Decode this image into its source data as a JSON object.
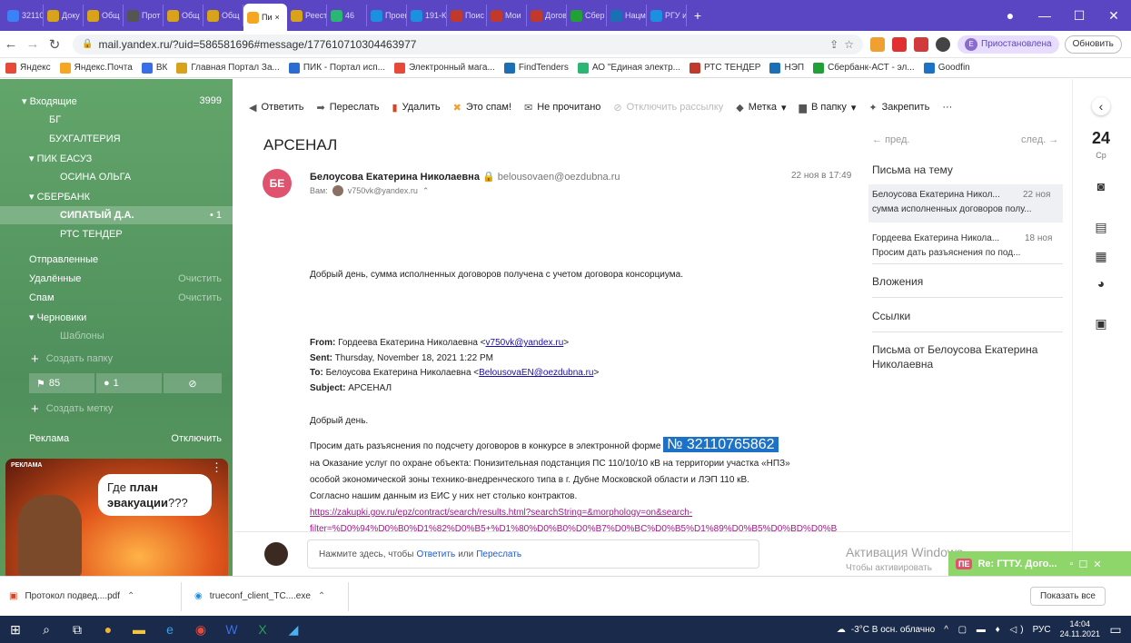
{
  "colors": {
    "tabbar": "#5a46c2",
    "sidebar": "#5a9a62",
    "highlight": "#1d72c7",
    "avatar": "#e0536f",
    "popup": "#8fd66a",
    "taskbar": "#1a2a4a"
  },
  "tabs": [
    {
      "label": "32110",
      "icon": "blue-dot-icon",
      "color": "#3b82f6"
    },
    {
      "label": "Доку",
      "icon": "sun-icon",
      "color": "#d9a21b"
    },
    {
      "label": "Общ",
      "icon": "sun-icon",
      "color": "#d9a21b"
    },
    {
      "label": "Прот",
      "icon": "globe-icon",
      "color": "#555"
    },
    {
      "label": "Общ",
      "icon": "sun-icon",
      "color": "#d9a21b"
    },
    {
      "label": "Общ",
      "icon": "sun-icon",
      "color": "#d9a21b"
    },
    {
      "label": "Пи",
      "icon": "yandex-mail-icon",
      "color": "#f5a623",
      "active": true
    },
    {
      "label": "Реест",
      "icon": "sun-icon",
      "color": "#d9a21b"
    },
    {
      "label": "46",
      "icon": "app-icon",
      "color": "#2bb673"
    },
    {
      "label": "Проек",
      "icon": "app-icon",
      "color": "#1d8fe1"
    },
    {
      "label": "191-К",
      "icon": "app-icon",
      "color": "#1d8fe1"
    },
    {
      "label": "Поис",
      "icon": "rts-icon",
      "color": "#c0392b"
    },
    {
      "label": "Мои",
      "icon": "rts-icon",
      "color": "#c0392b"
    },
    {
      "label": "Догов",
      "icon": "rts-icon",
      "color": "#c0392b"
    },
    {
      "label": "Сбер",
      "icon": "sber-icon",
      "color": "#21a038"
    },
    {
      "label": "Нацм",
      "icon": "nac-icon",
      "color": "#1a6fb5"
    },
    {
      "label": "РГУ и",
      "icon": "rgu-icon",
      "color": "#1d8fe1"
    }
  ],
  "address": {
    "url": "mail.yandex.ru/?uid=586581696#message/177610710304463977",
    "profile_label": "Приостановлена",
    "update_label": "Обновить",
    "profile_letter": "Е"
  },
  "bookmarks": [
    "Яндекс",
    "Яндекс.Почта",
    "ВК",
    "Главная Портал За...",
    "ПИК - Портал исп...",
    "Электронный мага...",
    "FindTenders",
    "АО \"Единая электр...",
    "РТС ТЕНДЕР",
    "НЭП",
    "Сбербанк-АСТ - эл...",
    "Goodfin"
  ],
  "sidebar": {
    "inbox": {
      "label": "▾ Входящие",
      "count": "3999"
    },
    "items": [
      {
        "label": "БГ",
        "indent": 2
      },
      {
        "label": "БУХГАЛТЕРИЯ",
        "indent": 2
      },
      {
        "label": "▾ ПИК ЕАСУЗ",
        "indent": 1
      },
      {
        "label": "ОСИНА ОЛЬГА",
        "indent": 3
      },
      {
        "label": "▾ СБЕРБАНК",
        "indent": 1
      },
      {
        "label": "СИПАТЫЙ Д.А.",
        "indent": 3,
        "count": "• 1",
        "bold": true
      },
      {
        "label": "РТС ТЕНДЕР",
        "indent": 3
      }
    ],
    "sent": "Отправленные",
    "deleted": "Удалённые",
    "deleted_action": "Очистить",
    "spam": "Спам",
    "spam_action": "Очистить",
    "drafts": "▾ Черновики",
    "templates": "Шаблоны",
    "create_folder": "Создать папку",
    "flag_count": "85",
    "dot_count": "1",
    "create_label": "Создать метку",
    "ads_label": "Реклама",
    "ads_disable": "Отключить",
    "ad_tag": "РЕКЛАМА",
    "ad_text_1": "Где ",
    "ad_text_bold": "план",
    "ad_text_2": "эвакуации",
    "ad_text_3": "???"
  },
  "toolbar": [
    "Ответить",
    "Переслать",
    "Удалить",
    "Это спам!",
    "Не прочитано",
    "Отключить рассылку",
    "Метка",
    "В папку",
    "Закрепить",
    "···"
  ],
  "message": {
    "subject": "АРСЕНАЛ",
    "avatar": "БЕ",
    "from_name": "Белоусова Екатерина Николаевна",
    "from_email": "belousovaen@oezdubna.ru",
    "date": "22 ноя в 17:49",
    "to_label": "Вам:",
    "to_email": "v750vk@yandex.ru",
    "greeting_line": "Добрый день, сумма исполненных договоров получена с учетом договора консорциума.",
    "fwd_from_label": "From:",
    "fwd_from": " Гордеева Екатерина Николаевна <",
    "fwd_from_email": "v750vk@yandex.ru",
    "fwd_from_end": ">",
    "fwd_sent_label": "Sent:",
    "fwd_sent": " Thursday, November 18, 2021 1:22 PM",
    "fwd_to_label": "To:",
    "fwd_to": " Белоусова Екатерина Николаевна <",
    "fwd_to_email": "BelousovaEN@oezdubna.ru",
    "fwd_to_end": ">",
    "fwd_subject_label": "Subject:",
    "fwd_subject": " АРСЕНАЛ",
    "hello": "Добрый день.",
    "body_1": "Просим дать разъяснения по подсчету договоров в конкурсе в электронной форме ",
    "highlight": "№ 32110765862",
    "body_2": "на Оказание услуг по охране объекта: Понизительная подстанция ПС 110/10/10 кВ на территории участка «НПЗ»",
    "body_3": "особой экономической зоны технико-внедренческого типа в г. Дубне Московской области и ЛЭП 110 кВ.",
    "body_4": "Согласно нашим данным из ЕИС у них нет столько контрактов.",
    "link_1": "https://zakupki.gov.ru/epz/contract/search/results.html?searchString=&morphology=on&search-",
    "link_2": "filter=%D0%94%D0%B0%D1%82%D0%B5+%D1%80%D0%B0%D0%B7%D0%BC%D0%B5%D1%89%D0%B5%D0%BD%D0%B"
  },
  "right_panel": {
    "prev": "пред.",
    "next": "след.",
    "thread_title": "Письма на тему",
    "thread": [
      {
        "name": "Белоусова Екатерина Никол...",
        "date": "22 ноя",
        "snippet": "сумма исполненных договоров полу..."
      },
      {
        "name": "Гордеева Екатерина Никола...",
        "date": "18 ноя",
        "snippet": "Просим дать разъяснения по под..."
      }
    ],
    "attachments": "Вложения",
    "links": "Ссылки",
    "from_title_1": "Письма от Белоусова Екатерина",
    "from_title_2": "Николаевна"
  },
  "rail": {
    "day": "24",
    "weekday": "Ср"
  },
  "reply": {
    "prefix": "Нажмите здесь, чтобы ",
    "reply": "Ответить",
    "or": " или ",
    "forward": "Переслать"
  },
  "watermark": {
    "line1": "Активация Windows",
    "line2": "Чтобы активировать"
  },
  "popup": {
    "badge": "ПЕ",
    "text": "Re: ГТТУ. Дого..."
  },
  "downloads": [
    {
      "name": "Протокол подвед....pdf",
      "icon": "pdf-icon"
    },
    {
      "name": "trueconf_client_TC....exe",
      "icon": "trueconf-icon"
    }
  ],
  "downloads_show_all": "Показать все",
  "taskbar": {
    "weather": "-3°C В осн. облачно",
    "lang": "РУС",
    "time": "14:04",
    "date": "24.11.2021"
  }
}
